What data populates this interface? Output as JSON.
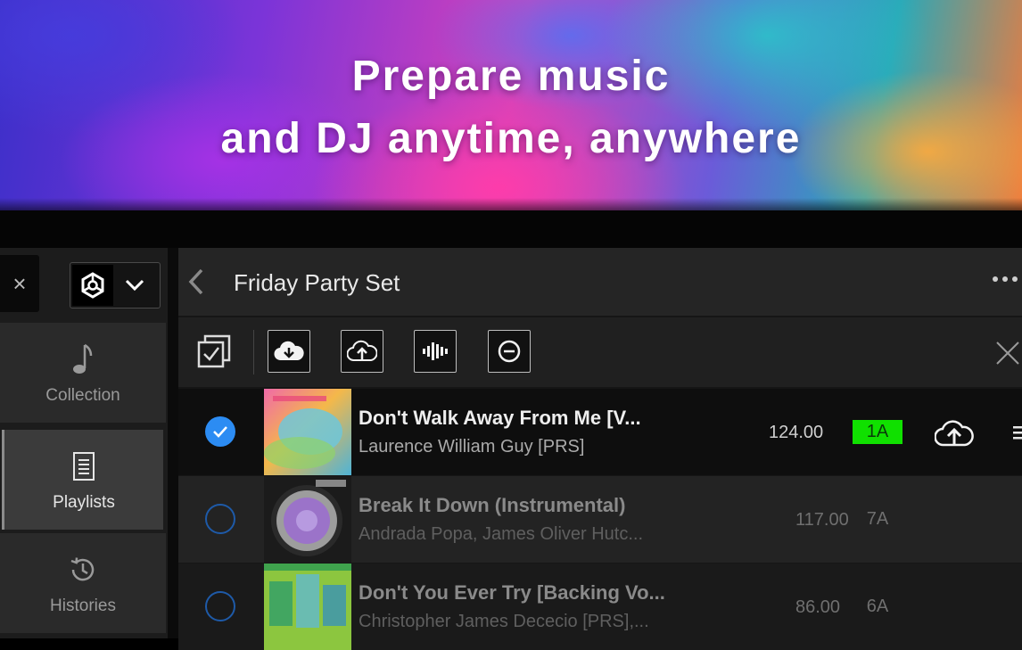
{
  "hero": {
    "line1": "Prepare music",
    "line2": "and DJ anytime, anywhere"
  },
  "sidebar": {
    "close_glyph": "×",
    "logo_icon": "rekordbox-logo-icon",
    "items": [
      {
        "label": "Collection",
        "icon": "music-note-icon"
      },
      {
        "label": "Playlists",
        "icon": "playlist-icon",
        "selected": true
      },
      {
        "label": "Histories",
        "icon": "history-icon"
      }
    ]
  },
  "header": {
    "title": "Friday Party Set"
  },
  "toolbar": {
    "buttons": [
      "select-all-icon",
      "download-cloud-icon",
      "upload-cloud-icon",
      "waveform-icon",
      "remove-icon",
      "close-icon"
    ]
  },
  "tracks": [
    {
      "title": "Don't Walk Away From Me [V...",
      "artist": "Laurence William Guy [PRS]",
      "bpm": "124.00",
      "key": "1A",
      "selected": true
    },
    {
      "title": "Break It Down (Instrumental)",
      "artist": "Andrada Popa, James Oliver Hutc...",
      "bpm": "117.00",
      "key": "7A",
      "selected": false
    },
    {
      "title": "Don't You Ever Try [Backing Vo...",
      "artist": "Christopher James Dececio [PRS],...",
      "bpm": "86.00",
      "key": "6A",
      "selected": false
    }
  ],
  "colors": {
    "accent_blue": "#2c8cf3",
    "key_highlight": "#10e000"
  }
}
